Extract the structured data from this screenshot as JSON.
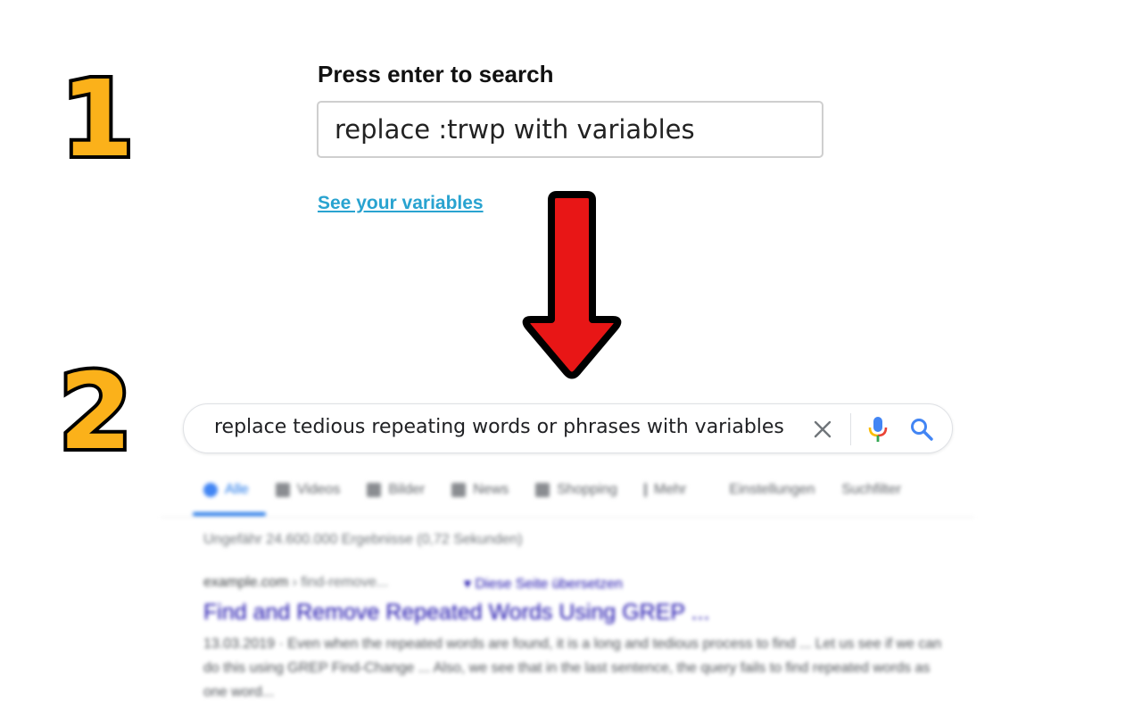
{
  "steps": {
    "one": "1",
    "two": "2"
  },
  "part1": {
    "label": "Press enter to search",
    "input_value": "replace :trwp with variables",
    "link": "See your variables"
  },
  "search": {
    "query": "replace tedious repeating words or phrases with variables",
    "icons": {
      "clear": "close-icon",
      "mic": "microphone-icon",
      "search": "search-icon"
    }
  },
  "tabs": [
    {
      "label": "Alle",
      "icon": "google-search-icon"
    },
    {
      "label": "Videos",
      "icon": "video-icon"
    },
    {
      "label": "Bilder",
      "icon": "image-icon"
    },
    {
      "label": "News",
      "icon": "news-icon"
    },
    {
      "label": "Shopping",
      "icon": "tag-icon"
    },
    {
      "label": "Mehr",
      "icon": "more-vertical-icon"
    }
  ],
  "tools": {
    "settings": "Einstellungen",
    "filter": "Suchfilter"
  },
  "results": {
    "stats": "Ungefähr 24.600.000 Ergebnisse (0,72 Sekunden)",
    "first": {
      "domain": "example.com",
      "path": " › find-remove...",
      "translate": "▾ Diese Seite übersetzen",
      "title": "Find and Remove Repeated Words Using GREP ...",
      "snippet": "13.03.2019 · Even when the repeated words are found, it is a long and tedious process to find ... Let us see if we can do this using GREP Find-Change ... Also, we see that in the last sentence, the query fails to find repeated words as one word..."
    }
  },
  "colors": {
    "step_number": "#fbb11a",
    "arrow": "#e81616",
    "link": "#29a3d0",
    "google_blue": "#1a73e8"
  }
}
